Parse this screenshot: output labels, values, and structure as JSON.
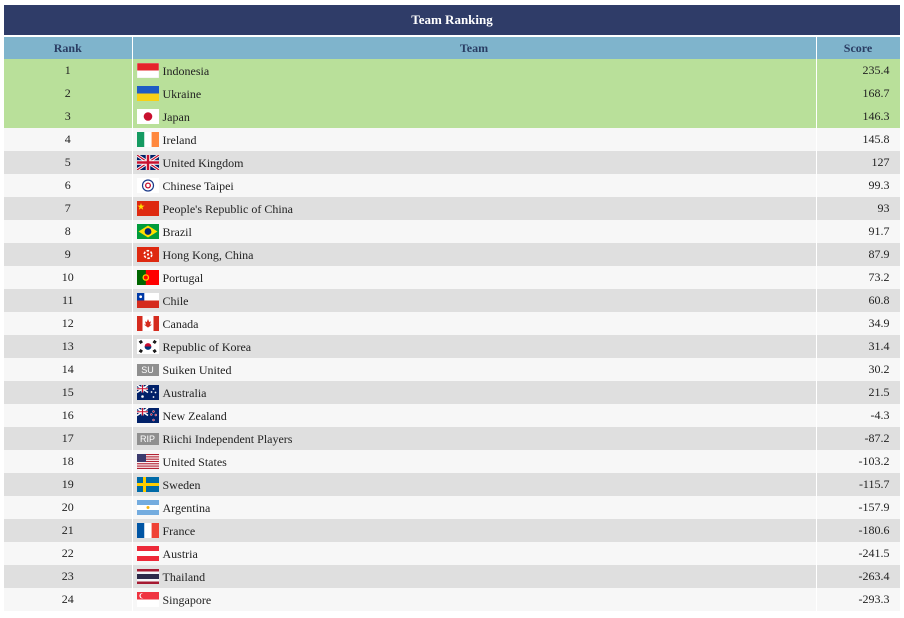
{
  "table": {
    "title": "Team Ranking",
    "headers": {
      "rank": "Rank",
      "team": "Team",
      "score": "Score"
    },
    "rows": [
      {
        "rank": "1",
        "team": "Indonesia",
        "score": "235.4",
        "flag": "flag-indonesia-icon"
      },
      {
        "rank": "2",
        "team": "Ukraine",
        "score": "168.7",
        "flag": "flag-ukraine-icon"
      },
      {
        "rank": "3",
        "team": "Japan",
        "score": "146.3",
        "flag": "flag-japan-icon"
      },
      {
        "rank": "4",
        "team": "Ireland",
        "score": "145.8",
        "flag": "flag-ireland-icon"
      },
      {
        "rank": "5",
        "team": "United Kingdom",
        "score": "127",
        "flag": "flag-united-kingdom-icon"
      },
      {
        "rank": "6",
        "team": "Chinese Taipei",
        "score": "99.3",
        "flag": "flag-chinese-taipei-icon"
      },
      {
        "rank": "7",
        "team": "People's Republic of China",
        "score": "93",
        "flag": "flag-china-icon"
      },
      {
        "rank": "8",
        "team": "Brazil",
        "score": "91.7",
        "flag": "flag-brazil-icon"
      },
      {
        "rank": "9",
        "team": "Hong Kong, China",
        "score": "87.9",
        "flag": "flag-hong-kong-icon"
      },
      {
        "rank": "10",
        "team": "Portugal",
        "score": "73.2",
        "flag": "flag-portugal-icon"
      },
      {
        "rank": "11",
        "team": "Chile",
        "score": "60.8",
        "flag": "flag-chile-icon"
      },
      {
        "rank": "12",
        "team": "Canada",
        "score": "34.9",
        "flag": "flag-canada-icon"
      },
      {
        "rank": "13",
        "team": "Republic of Korea",
        "score": "31.4",
        "flag": "flag-korea-icon"
      },
      {
        "rank": "14",
        "team": "Suiken United",
        "score": "30.2",
        "flag": "tag-icon",
        "tag": "SU"
      },
      {
        "rank": "15",
        "team": "Australia",
        "score": "21.5",
        "flag": "flag-australia-icon"
      },
      {
        "rank": "16",
        "team": "New Zealand",
        "score": "-4.3",
        "flag": "flag-new-zealand-icon"
      },
      {
        "rank": "17",
        "team": "Riichi Independent Players",
        "score": "-87.2",
        "flag": "tag-icon",
        "tag": "RIP"
      },
      {
        "rank": "18",
        "team": "United States",
        "score": "-103.2",
        "flag": "flag-united-states-icon"
      },
      {
        "rank": "19",
        "team": "Sweden",
        "score": "-115.7",
        "flag": "flag-sweden-icon"
      },
      {
        "rank": "20",
        "team": "Argentina",
        "score": "-157.9",
        "flag": "flag-argentina-icon"
      },
      {
        "rank": "21",
        "team": "France",
        "score": "-180.6",
        "flag": "flag-france-icon"
      },
      {
        "rank": "22",
        "team": "Austria",
        "score": "-241.5",
        "flag": "flag-austria-icon"
      },
      {
        "rank": "23",
        "team": "Thailand",
        "score": "-263.4",
        "flag": "flag-thailand-icon"
      },
      {
        "rank": "24",
        "team": "Singapore",
        "score": "-293.3",
        "flag": "flag-singapore-icon"
      }
    ]
  },
  "colors": {
    "title_bg": "#2f3c68",
    "header_bg": "#7fb4cc",
    "top3_bg": "#b9e09a",
    "row_dark": "#dfdfdf",
    "row_light": "#f7f7f7"
  }
}
